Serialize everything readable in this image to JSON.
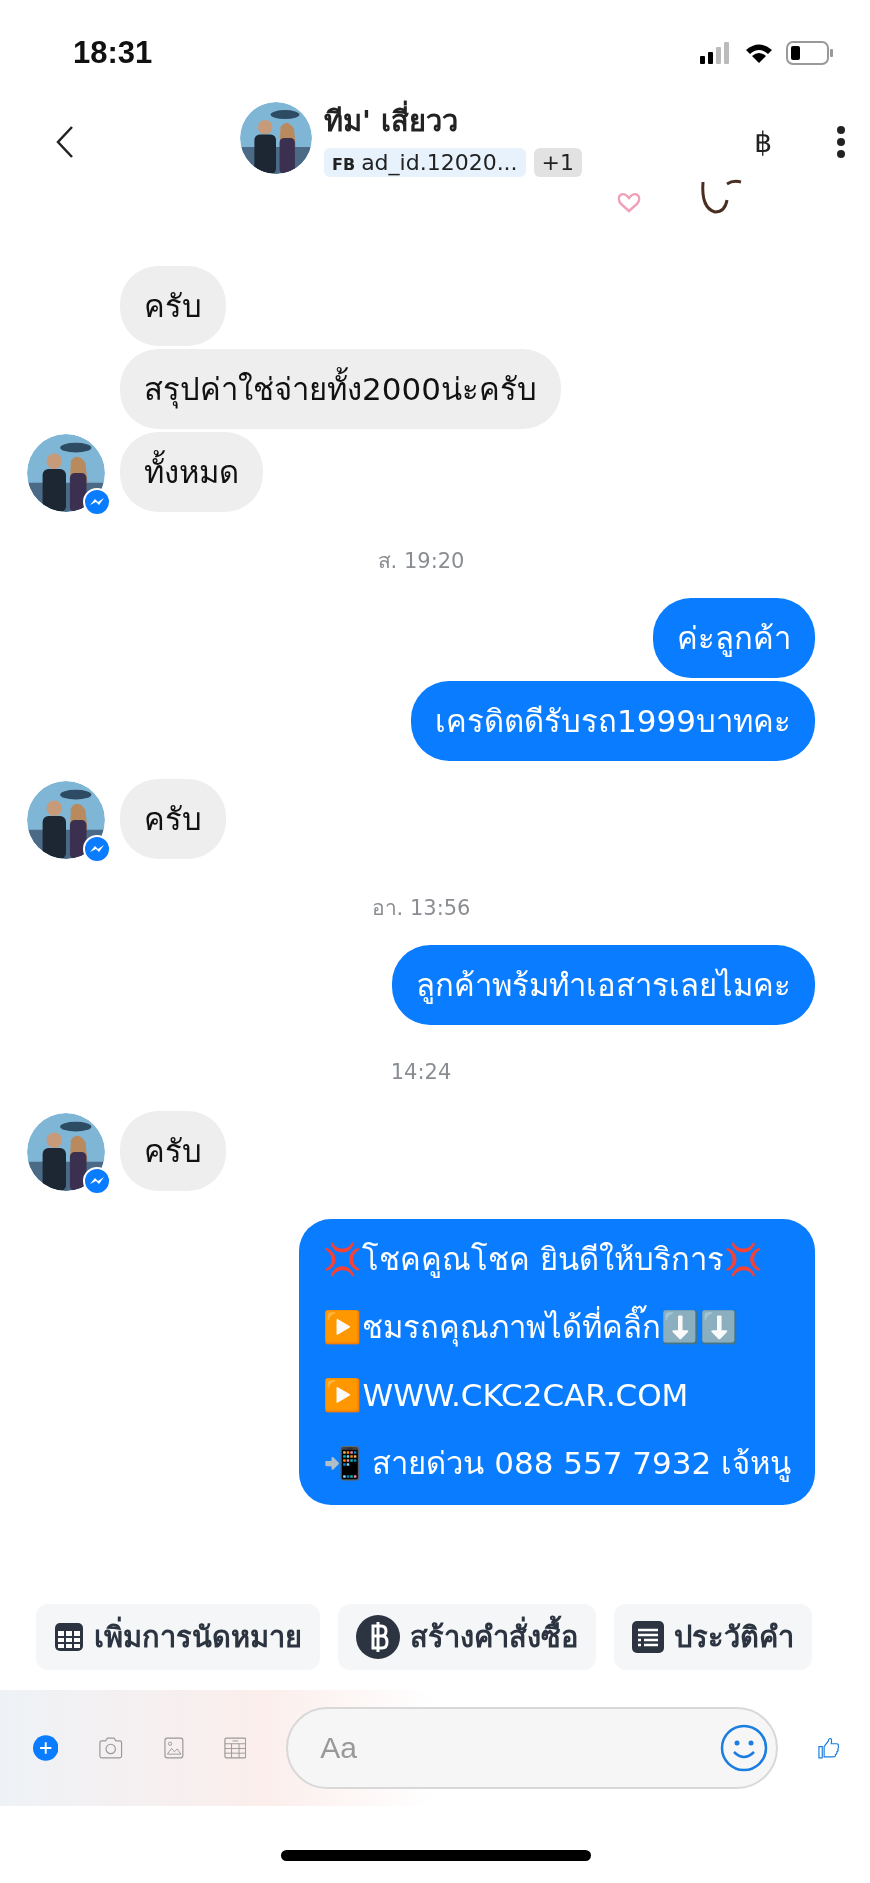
{
  "status_bar": {
    "time": "18:31"
  },
  "header": {
    "name": "ทีม' เสี่ยวว",
    "tag_prefix": "FB",
    "tag": "ad_id.12020...",
    "extra_tags": "+1",
    "currency_button": "฿"
  },
  "thread": [
    {
      "kind": "incoming",
      "messages": [
        "ครับ",
        "สรุปค่าใช่จ่ายทั้ง2000น่ะครับ",
        "ทั้งหมด"
      ]
    },
    {
      "kind": "time",
      "text": "ส. 19:20"
    },
    {
      "kind": "outgoing",
      "messages": [
        "ค่ะลูกค้า",
        "เครดิตดีรับรถ1999บาทคะ"
      ]
    },
    {
      "kind": "incoming",
      "messages": [
        "ครับ"
      ]
    },
    {
      "kind": "time",
      "text": "อา. 13:56"
    },
    {
      "kind": "outgoing",
      "messages": [
        "ลูกค้าพร้มทำเอสารเลยไมคะ"
      ]
    },
    {
      "kind": "time",
      "text": "14:24"
    },
    {
      "kind": "incoming",
      "messages": [
        "ครับ"
      ]
    },
    {
      "kind": "outgoing_multi",
      "lines": [
        "💢โชคคูณโชค ยินดีให้บริการ💢",
        "▶️ชมรถคุณภาพได้ที่คลิ๊ก⬇️⬇️",
        "▶️WWW.CKC2CAR.COM",
        "📲 สายด่วน 088 557 7932 เจ้หนู"
      ]
    }
  ],
  "quick_replies": [
    {
      "kind": "calendar",
      "label": "เพิ่มการนัดหมาย"
    },
    {
      "kind": "baht",
      "label": "สร้างคำสั่งซื้อ"
    },
    {
      "kind": "list",
      "label": "ประวัติคำ"
    }
  ],
  "composer": {
    "placeholder": "Aa"
  }
}
